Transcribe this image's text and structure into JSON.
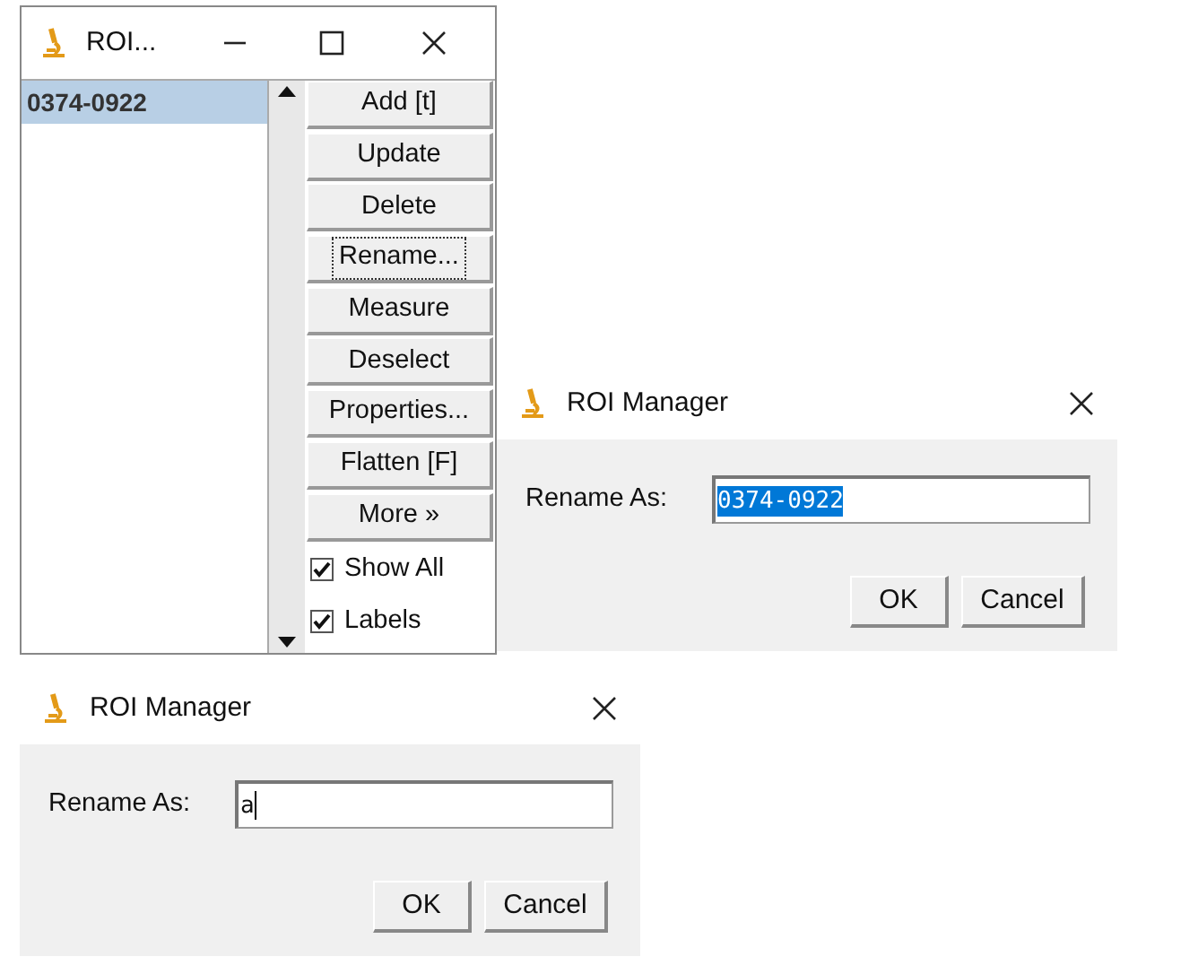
{
  "roi_manager": {
    "title": "ROI...",
    "list": [
      {
        "label": "0374-0922",
        "selected": true
      }
    ],
    "buttons": [
      {
        "label": "Add [t]",
        "focused": false
      },
      {
        "label": "Update",
        "focused": false
      },
      {
        "label": "Delete",
        "focused": false
      },
      {
        "label": "Rename...",
        "focused": true
      },
      {
        "label": "Measure",
        "focused": false
      },
      {
        "label": "Deselect",
        "focused": false
      },
      {
        "label": "Properties...",
        "focused": false
      },
      {
        "label": "Flatten [F]",
        "focused": false
      },
      {
        "label": "More »",
        "focused": false
      }
    ],
    "checkboxes": [
      {
        "label": "Show All",
        "checked": true
      },
      {
        "label": "Labels",
        "checked": true
      }
    ]
  },
  "rename_dialogs": [
    {
      "title": "ROI Manager",
      "label": "Rename As:",
      "value": "0374-0922",
      "value_selected": true,
      "buttons": [
        "OK",
        "Cancel"
      ]
    },
    {
      "title": "ROI Manager",
      "label": "Rename As:",
      "value": "a",
      "value_selected": false,
      "buttons": [
        "OK",
        "Cancel"
      ]
    }
  ]
}
